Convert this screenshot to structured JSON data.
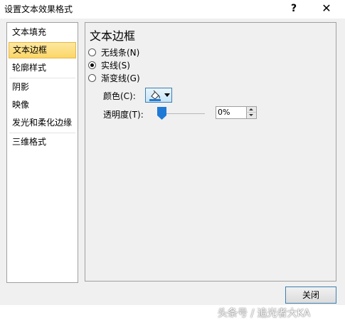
{
  "window": {
    "title": "设置文本效果格式",
    "help_label": "?",
    "close_glyph": "✕"
  },
  "nav": {
    "items": [
      {
        "label": "文本填充",
        "selected": false
      },
      {
        "label": "文本边框",
        "selected": true
      },
      {
        "label": "轮廓样式",
        "selected": false
      },
      {
        "label": "阴影",
        "selected": false
      },
      {
        "label": "映像",
        "selected": false
      },
      {
        "label": "发光和柔化边缘",
        "selected": false
      },
      {
        "label": "三维格式",
        "selected": false
      }
    ]
  },
  "content": {
    "section_title": "文本边框",
    "options": [
      {
        "label": "无线条(N)",
        "checked": false
      },
      {
        "label": "实线(S)",
        "checked": true
      },
      {
        "label": "渐变线(G)",
        "checked": false
      }
    ],
    "color_label": "颜色(C):",
    "transparency_label": "透明度(T):",
    "transparency_value": "0%",
    "transparency_level": 0,
    "color_icon": "paint-bucket-icon",
    "accent_color": "#1f7ad6"
  },
  "footer": {
    "close_label": "关闭"
  },
  "watermark": "头条号 / 追光者大KA"
}
